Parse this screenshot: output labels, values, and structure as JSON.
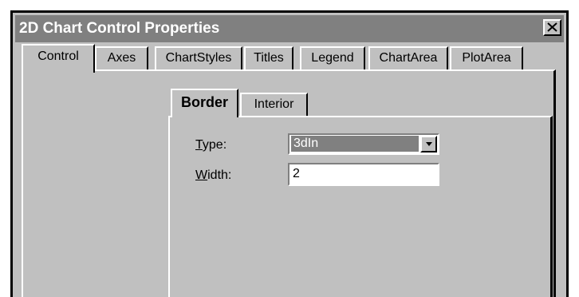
{
  "window": {
    "title": "2D Chart Control Properties",
    "close_icon": "close-x-icon"
  },
  "tabs": [
    {
      "label": "Control",
      "active": true
    },
    {
      "label": "Axes",
      "active": false
    },
    {
      "label": "ChartStyles",
      "active": false
    },
    {
      "label": "Titles",
      "active": false
    },
    {
      "label": "Legend",
      "active": false
    },
    {
      "label": "ChartArea",
      "active": false
    },
    {
      "label": "PlotArea",
      "active": false
    }
  ],
  "subtabs": [
    {
      "label": "Border",
      "active": true
    },
    {
      "label": "Interior",
      "active": false
    }
  ],
  "fields": {
    "type_label_accel": "T",
    "type_label_rest": "ype:",
    "type_value": "3dIn",
    "width_label_accel": "W",
    "width_label_rest": "idth:",
    "width_value": "2"
  },
  "colors": {
    "face": "#c0c0c0",
    "titlebar_inactive": "#808080",
    "selection": "#808080"
  }
}
